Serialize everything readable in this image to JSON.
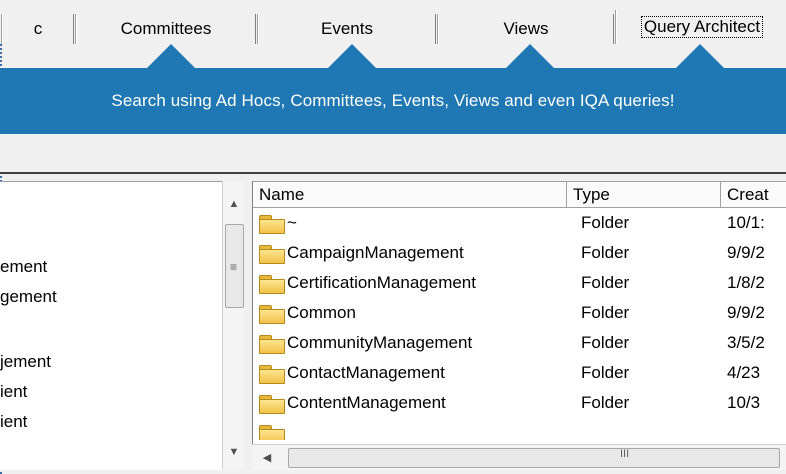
{
  "tabs": [
    {
      "label": "c"
    },
    {
      "label": "Committees"
    },
    {
      "label": "Events"
    },
    {
      "label": "Views"
    },
    {
      "label": "Query Architect"
    }
  ],
  "banner": {
    "text": "Search using Ad Hocs, Committees, Events, Views and even IQA queries!",
    "color": "#1f78b4"
  },
  "tree": {
    "items": [
      {
        "label": "ement"
      },
      {
        "label": "gement"
      },
      {
        "label": "jement"
      },
      {
        "label": "ient"
      },
      {
        "label": "ient"
      }
    ]
  },
  "list": {
    "columns": [
      {
        "label": "Name"
      },
      {
        "label": "Type"
      },
      {
        "label": "Creat"
      }
    ],
    "rows": [
      {
        "name": "~",
        "type": "Folder",
        "created": "10/1:"
      },
      {
        "name": "CampaignManagement",
        "type": "Folder",
        "created": "9/9/2"
      },
      {
        "name": "CertificationManagement",
        "type": "Folder",
        "created": "1/8/2"
      },
      {
        "name": "Common",
        "type": "Folder",
        "created": "9/9/2"
      },
      {
        "name": "CommunityManagement",
        "type": "Folder",
        "created": "3/5/2"
      },
      {
        "name": "ContactManagement",
        "type": "Folder",
        "created": "4/23"
      },
      {
        "name": "ContentManagement",
        "type": "Folder",
        "created": "10/3"
      }
    ]
  },
  "scroll": {
    "up_icon": "up-arrow-icon",
    "down_icon": "down-arrow-icon",
    "left_icon": "left-arrow-icon",
    "grip_h": "III",
    "grip_v": "≡"
  }
}
